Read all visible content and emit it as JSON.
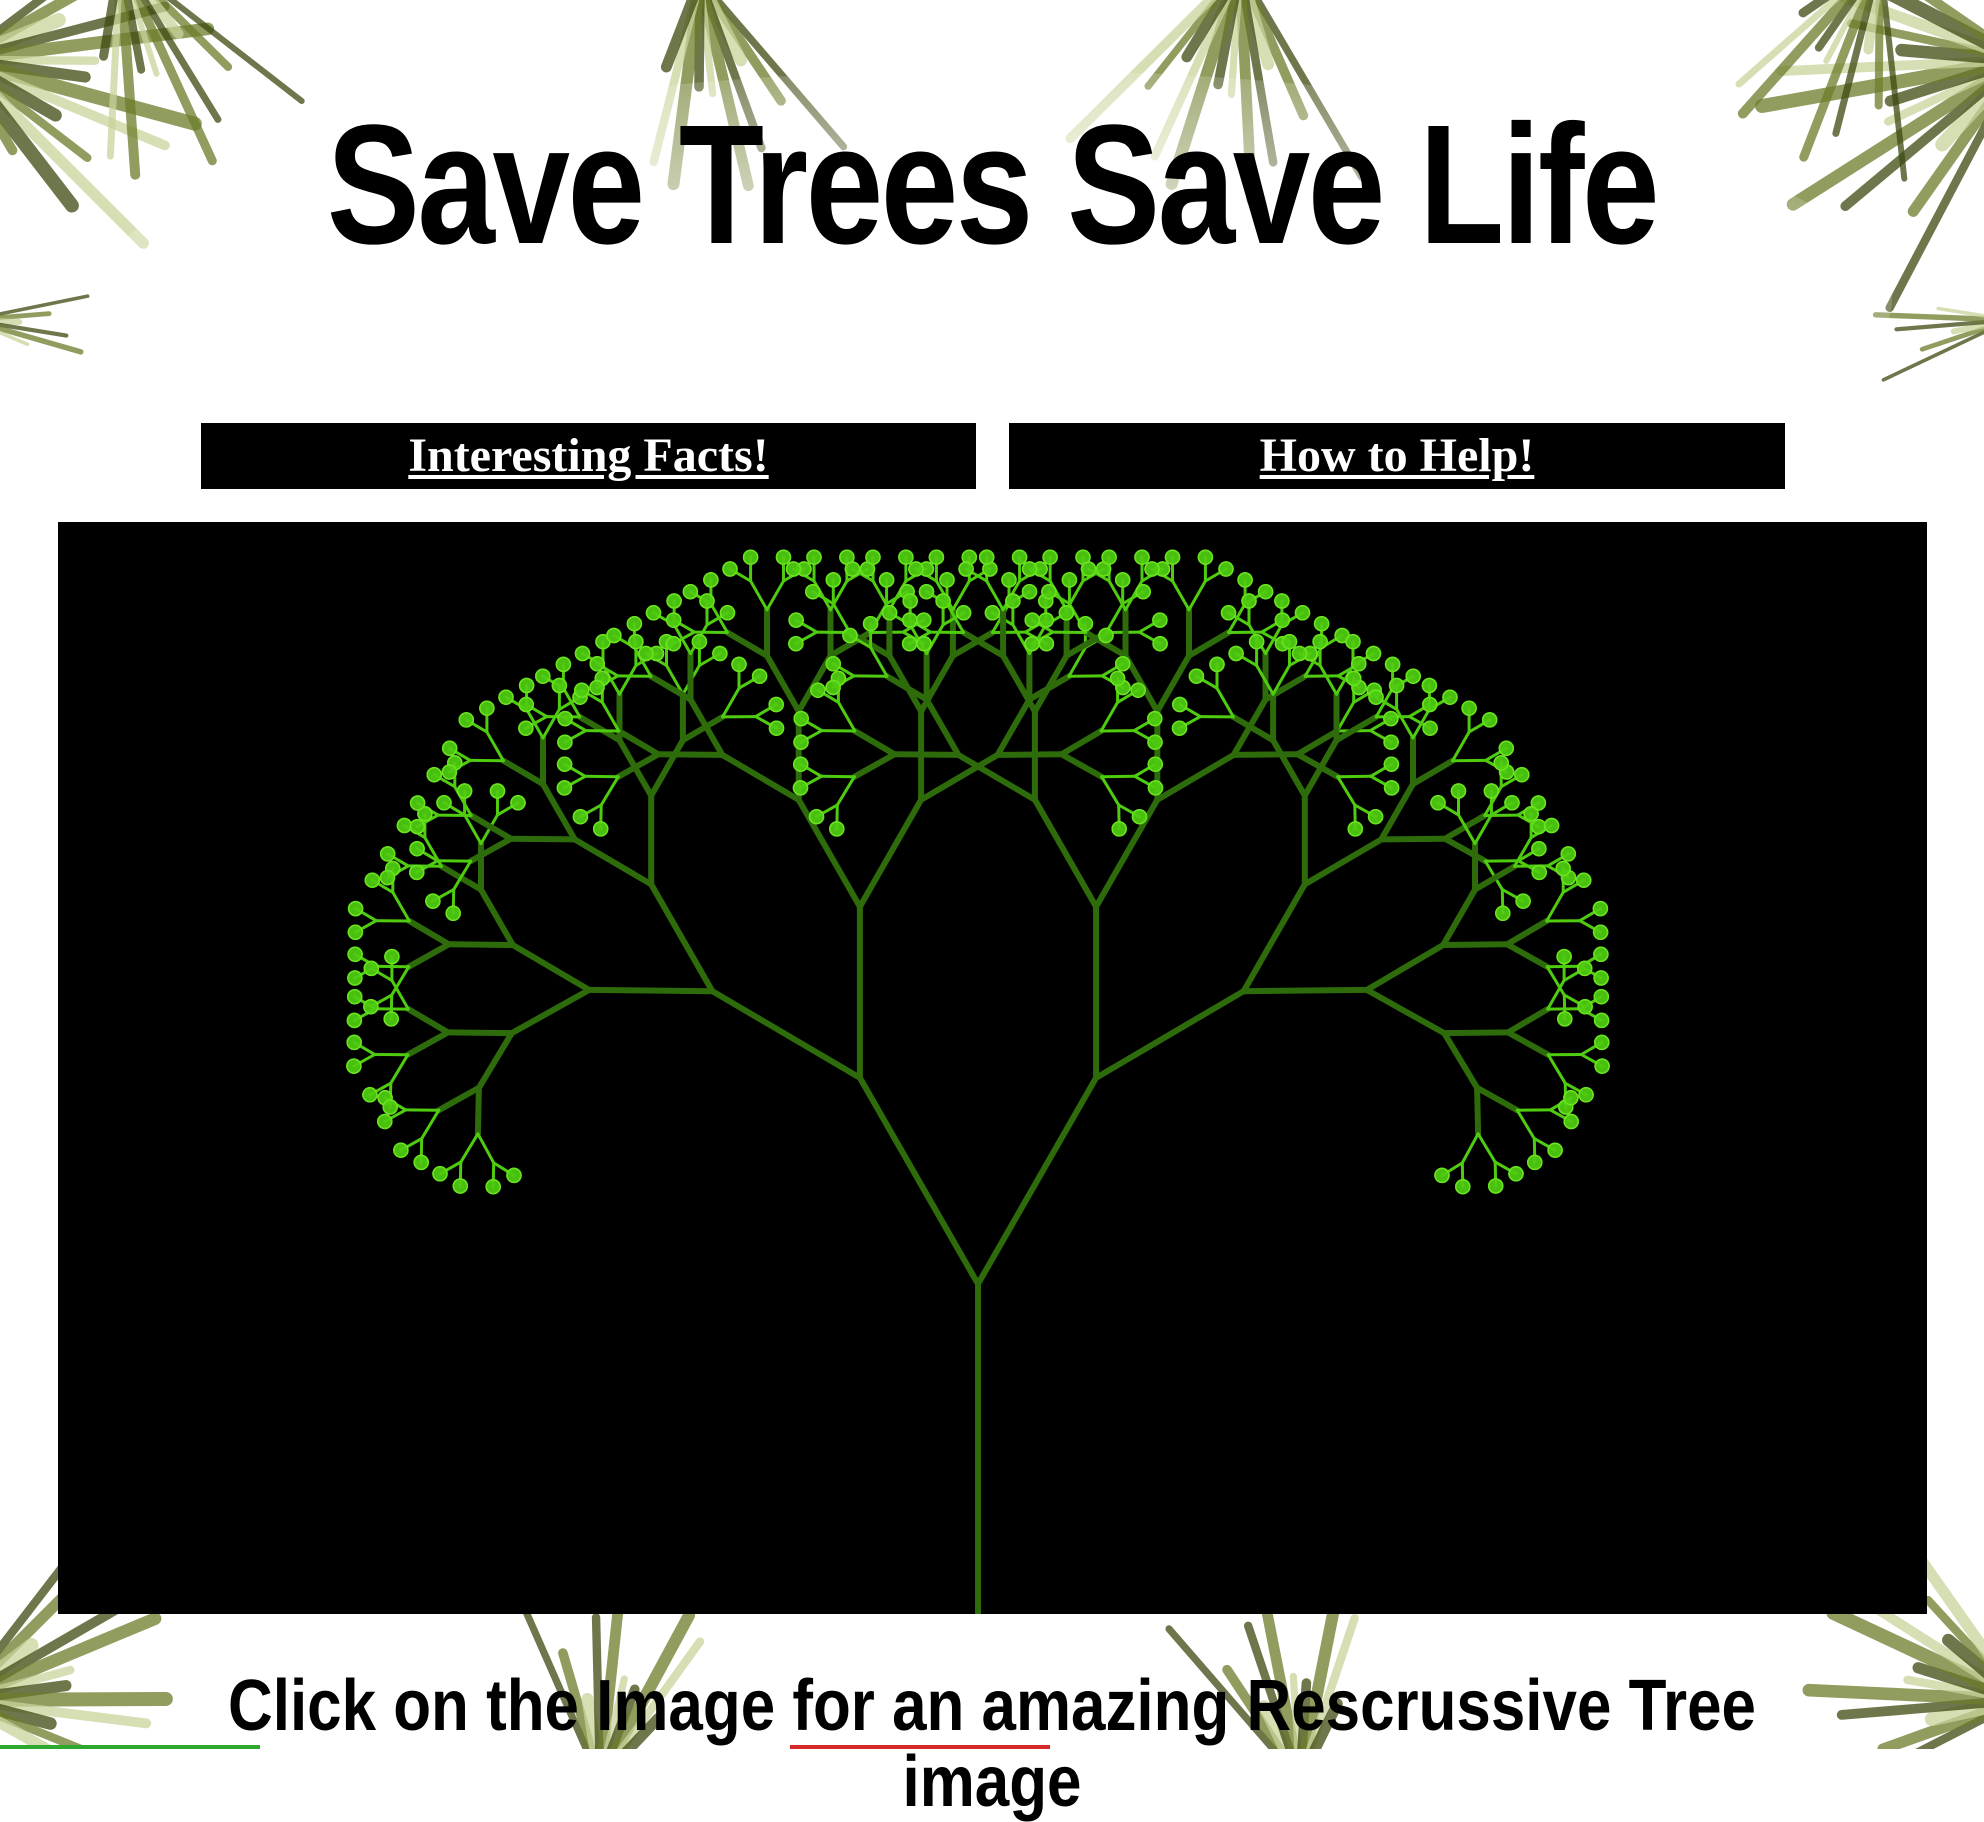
{
  "header": {
    "title": "Save Trees Save Life"
  },
  "nav": {
    "facts_label": "Interesting Facts!",
    "help_label": "How to Help!"
  },
  "tree_image": {
    "background_color": "#000000",
    "branch_color": "#2e6b0a",
    "leaf_color": "#4fcc10",
    "leaf_glow_color": "#6ae320"
  },
  "caption": {
    "text": "Click on the Image for an amazing Rescrussive Tree image"
  },
  "theme": {
    "frond_color": "#6b7d2a",
    "frond_dark": "#3d4a10",
    "frond_light": "#c9d39a"
  }
}
